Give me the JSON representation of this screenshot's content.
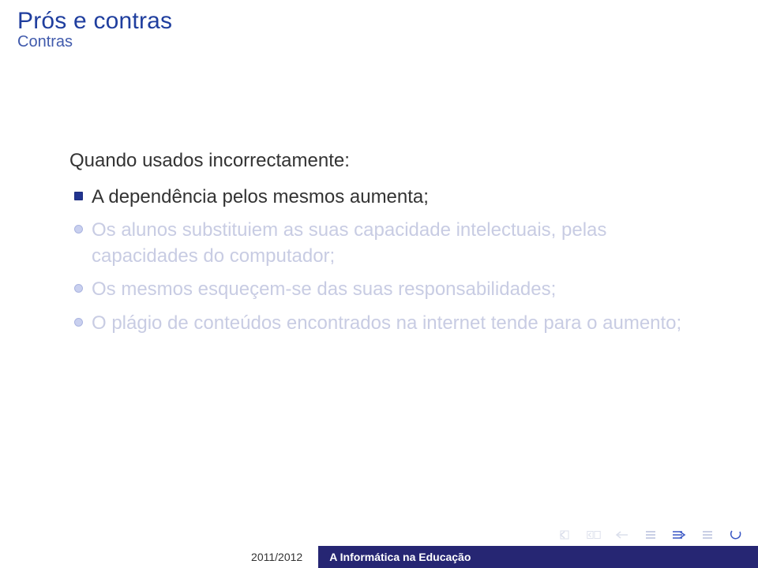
{
  "header": {
    "title": "Prós e contras",
    "subtitle": "Contras"
  },
  "content": {
    "lead": "Quando usados incorrectamente:",
    "bullets": [
      {
        "text": "A dependência pelos mesmos aumenta;",
        "active": true
      },
      {
        "text": "Os alunos substituiem as suas capacidade intelectuais, pelas capacidades do computador;",
        "active": false
      },
      {
        "text": "Os mesmos esqueçem-se das suas responsabilidades;",
        "active": false
      },
      {
        "text": "O plágio de conteúdos encontrados na internet tende para o aumento;",
        "active": false
      }
    ]
  },
  "footer": {
    "date": "2011/2012",
    "title": "A Informática na Educação"
  }
}
